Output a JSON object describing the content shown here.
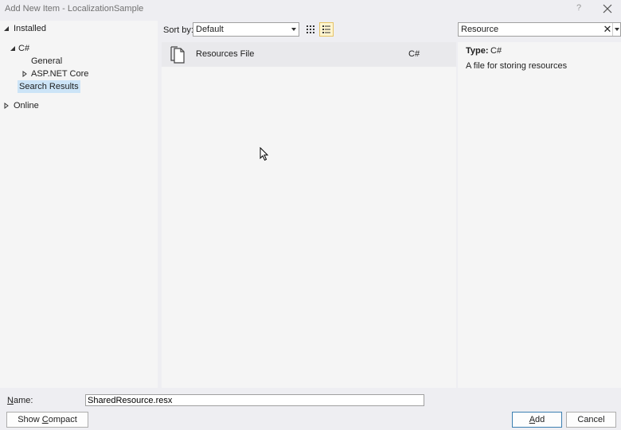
{
  "window": {
    "title": "Add New Item - LocalizationSample",
    "help_glyph": "?",
    "close_icon": "close-icon"
  },
  "tree": {
    "installed": "Installed",
    "csharp": "C#",
    "general": "General",
    "aspnet_core": "ASP.NET Core",
    "search_results": "Search Results",
    "online": "Online"
  },
  "toolbar": {
    "sort_label": "Sort by:",
    "sort_value": "Default",
    "view_small_icons": "grid-view-icon",
    "view_list_icon": "list-view-icon"
  },
  "search": {
    "value": "Resource",
    "clear_glyph": "✕"
  },
  "templates": [
    {
      "name": "Resources File",
      "language": "C#",
      "icon": "resource-file-icon"
    }
  ],
  "details": {
    "type_label": "Type:",
    "type_value": "C#",
    "description": "A file for storing resources"
  },
  "bottom": {
    "name_label_prefix": "N",
    "name_label_rest": "ame:",
    "name_value": "SharedResource.resx",
    "compact_prefix": "Show ",
    "compact_underlined": "C",
    "compact_rest": "ompact View",
    "add_underlined": "A",
    "add_rest": "dd",
    "cancel": "Cancel"
  },
  "colors": {
    "selection": "#cce4f7",
    "background": "#eeeef2",
    "panel": "#f5f5f5"
  }
}
